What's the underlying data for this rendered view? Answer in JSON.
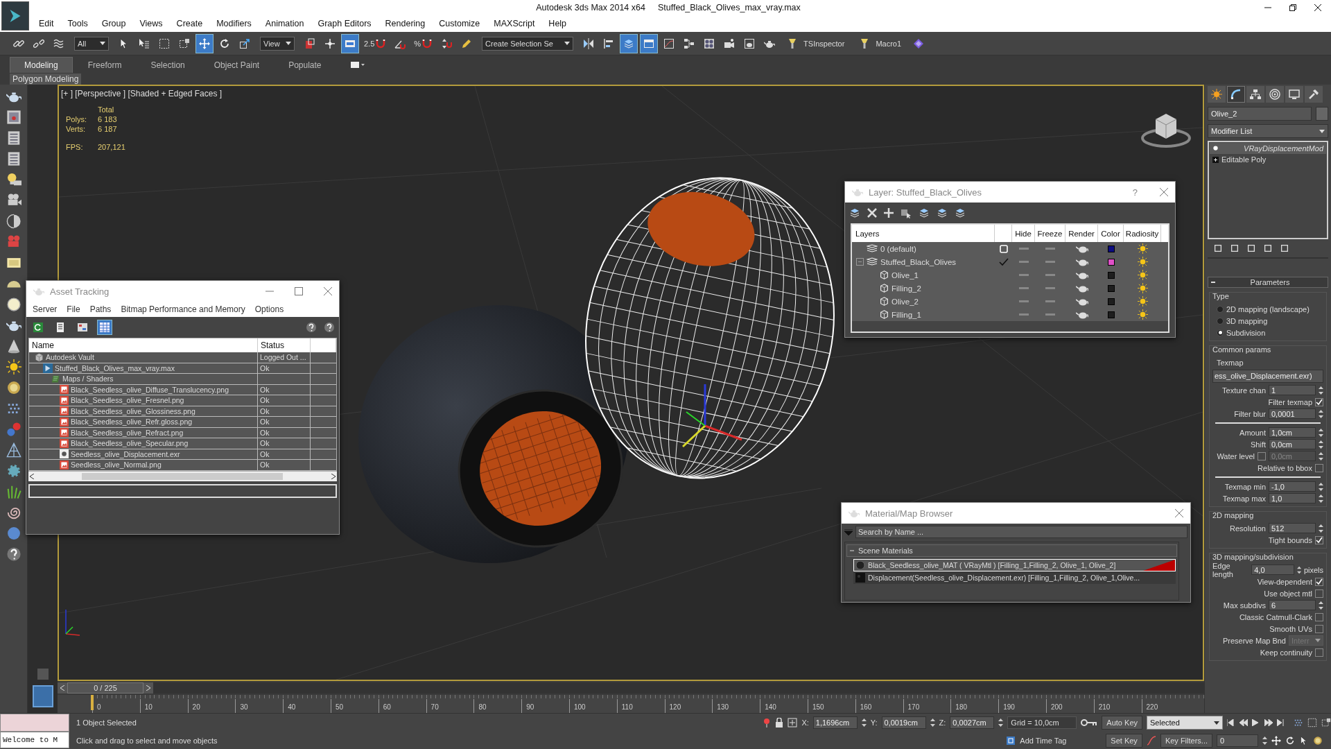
{
  "window": {
    "app_title": "Autodesk 3ds Max  2014 x64",
    "file_title": "Stuffed_Black_Olives_max_vray.max"
  },
  "menu": [
    "Edit",
    "Tools",
    "Group",
    "Views",
    "Create",
    "Modifiers",
    "Animation",
    "Graph Editors",
    "Rendering",
    "Customize",
    "MAXScript",
    "Help"
  ],
  "toolbar": {
    "tools": [
      {
        "kind": "link",
        "selected": false
      },
      {
        "kind": "unlink",
        "selected": false
      },
      {
        "kind": "bind",
        "selected": false
      },
      {
        "kind": "dropdown",
        "value": "All"
      },
      {
        "kind": "select",
        "selected": false
      },
      {
        "kind": "select_list",
        "selected": false
      },
      {
        "kind": "rect_select",
        "selected": false
      },
      {
        "kind": "window",
        "selected": false
      },
      {
        "kind": "move",
        "selected": true
      },
      {
        "kind": "rotate",
        "selected": false
      },
      {
        "kind": "scale",
        "selected": false
      },
      {
        "kind": "dropdown",
        "value": "View"
      },
      {
        "kind": "pivot",
        "selected": false
      },
      {
        "kind": "manip",
        "selected": false
      },
      {
        "kind": "kbd",
        "selected": true
      },
      {
        "kind": "snap",
        "label": "2.5",
        "selected": false
      },
      {
        "kind": "angle",
        "selected": false
      },
      {
        "kind": "percent",
        "label": "%",
        "selected": false
      },
      {
        "kind": "spinner_snap",
        "selected": false
      },
      {
        "kind": "edit_named",
        "selected": false
      },
      {
        "kind": "dropdown",
        "value": "Create Selection Se"
      },
      {
        "kind": "mirror",
        "selected": false
      },
      {
        "kind": "align",
        "selected": false
      },
      {
        "kind": "layers",
        "selected": true
      },
      {
        "kind": "ribbon",
        "selected": true
      },
      {
        "kind": "curve",
        "selected": false
      },
      {
        "kind": "schematic",
        "selected": false
      },
      {
        "kind": "material",
        "selected": false
      },
      {
        "kind": "render_setup",
        "selected": false
      },
      {
        "kind": "render_frame",
        "selected": false
      },
      {
        "kind": "render",
        "selected": false
      },
      {
        "kind": "script",
        "label": "TSInspector",
        "selected": false
      },
      {
        "kind": "script",
        "label": "Macro1",
        "selected": false
      },
      {
        "kind": "diamond",
        "selected": false
      }
    ]
  },
  "ribbon": {
    "tabs": [
      {
        "label": "Modeling",
        "selected": true
      },
      {
        "label": "Freeform",
        "selected": false
      },
      {
        "label": "Selection",
        "selected": false
      },
      {
        "label": "Object Paint",
        "selected": false
      },
      {
        "label": "Populate",
        "selected": false
      }
    ],
    "panel_label": "Polygon Modeling"
  },
  "viewport": {
    "label": "[+ ] [Perspective ] [Shaded + Edged Faces ]",
    "stats_header": "Total",
    "stats": [
      {
        "label": "Polys:",
        "value": "6 183"
      },
      {
        "label": "Verts:",
        "value": "6 187"
      },
      {
        "label": "FPS:",
        "value": "207,121"
      }
    ]
  },
  "asset_tracking": {
    "title": "Asset Tracking",
    "menu": [
      "Server",
      "File",
      "Paths",
      "Bitmap Performance and Memory",
      "Options"
    ],
    "tools": [
      {
        "kind": "refresh",
        "selected": false
      },
      {
        "kind": "list",
        "selected": false
      },
      {
        "kind": "tree",
        "selected": false
      },
      {
        "kind": "table",
        "selected": true
      }
    ],
    "columns": [
      "Name",
      "Status"
    ],
    "rows": [
      {
        "kind": "vault",
        "name": "Autodesk Vault",
        "status": "Logged Out ...",
        "children": [
          {
            "kind": "max",
            "name": "Stuffed_Black_Olives_max_vray.max",
            "status": "Ok",
            "children": [
              {
                "kind": "folder",
                "name": "Maps / Shaders",
                "children": [
                  {
                    "kind": "image",
                    "name": "Black_Seedless_olive_Diffuse_Translucency.png",
                    "status": "Ok"
                  },
                  {
                    "kind": "image",
                    "name": "Black_Seedless_olive_Fresnel.png",
                    "status": "Ok"
                  },
                  {
                    "kind": "image",
                    "name": "Black_Seedless_olive_Glossiness.png",
                    "status": "Ok"
                  },
                  {
                    "kind": "image",
                    "name": "Black_Seedless_olive_Refr.gloss.png",
                    "status": "Ok"
                  },
                  {
                    "kind": "image",
                    "name": "Black_Seedless_olive_Refract.png",
                    "status": "Ok"
                  },
                  {
                    "kind": "image",
                    "name": "Black_Seedless_olive_Specular.png",
                    "status": "Ok"
                  },
                  {
                    "kind": "exr",
                    "name": "Seedless_olive_Displacement.exr",
                    "status": "Ok"
                  },
                  {
                    "kind": "image",
                    "name": "Seedless_olive_Normal.png",
                    "status": "Ok"
                  }
                ]
              }
            ]
          }
        ]
      }
    ]
  },
  "layer_dialog": {
    "title": "Layer: Stuffed_Black_Olives",
    "help": "?",
    "columns": [
      "Layers",
      "Hide",
      "Freeze",
      "Render",
      "Color",
      "Radiosity"
    ],
    "rows": [
      {
        "name": "0 (default)",
        "kind": "layer",
        "current": false,
        "hidden": false,
        "frozen": false,
        "renderable": true,
        "color": "#0c0c80"
      },
      {
        "name": "Stuffed_Black_Olives",
        "kind": "layer",
        "current": true,
        "expanded": true,
        "hidden": false,
        "frozen": false,
        "renderable": true,
        "color": "#e050c8",
        "children": [
          {
            "name": "Olive_1",
            "kind": "object",
            "hidden": false,
            "frozen": false,
            "renderable": true,
            "color": "#1e1e1e"
          },
          {
            "name": "Filling_2",
            "kind": "object",
            "hidden": false,
            "frozen": false,
            "renderable": true,
            "color": "#1e1e1e"
          },
          {
            "name": "Olive_2",
            "kind": "object",
            "hidden": false,
            "frozen": false,
            "renderable": true,
            "color": "#1e1e1e"
          },
          {
            "name": "Filling_1",
            "kind": "object",
            "hidden": false,
            "frozen": false,
            "renderable": true,
            "color": "#1e1e1e"
          }
        ]
      }
    ]
  },
  "material_browser": {
    "title": "Material/Map Browser",
    "search": {
      "placeholder": "Search by Name ..."
    },
    "group": {
      "label": "Scene Materials",
      "expanded": true
    },
    "items": [
      {
        "kind": "material",
        "label": "Black_Seedless_olive_MAT  ( VRayMtl )  [Filling_1,Filling_2, Olive_1, Olive_2]",
        "selected": true
      },
      {
        "kind": "map",
        "label": "Displacement(Seedless_olive_Displacement.exr) [Filling_1,Filling_2, Olive_1,Olive...",
        "selected": false
      }
    ]
  },
  "command_panel": {
    "tabs": [
      {
        "kind": "create",
        "selected": false
      },
      {
        "kind": "modify",
        "selected": true
      },
      {
        "kind": "hierarchy",
        "selected": false
      },
      {
        "kind": "motion",
        "selected": false
      },
      {
        "kind": "display",
        "selected": false
      },
      {
        "kind": "utilities",
        "selected": false
      }
    ],
    "object_name": "Olive_2",
    "modifier_list": "Modifier List",
    "stack": [
      {
        "label": "VRayDisplacementMod",
        "kind": "modifier",
        "selected": true
      },
      {
        "label": "Editable Poly",
        "kind": "base",
        "expanded": false,
        "selected": false
      }
    ],
    "rollout": "Parameters",
    "groups": [
      {
        "title": "Type",
        "rows": [
          {
            "kind": "radio",
            "label": "2D mapping (landscape)",
            "selected": false
          },
          {
            "kind": "radio",
            "label": "3D mapping",
            "selected": false
          },
          {
            "kind": "radio",
            "label": "Subdivision",
            "selected": true
          }
        ]
      },
      {
        "title": "Common params",
        "rows": [
          {
            "kind": "label",
            "label": "Texmap"
          },
          {
            "kind": "map",
            "value": "ess_olive_Displacement.exr)"
          },
          {
            "kind": "spinner",
            "label": "Texture chan",
            "value": "1"
          },
          {
            "kind": "check",
            "label": "Filter texmap",
            "checked": true
          },
          {
            "kind": "spinner",
            "label": "Filter blur",
            "value": "0,0001"
          },
          {
            "kind": "rule"
          },
          {
            "kind": "spinner",
            "label": "Amount",
            "value": "1,0cm"
          },
          {
            "kind": "spinner",
            "label": "Shift",
            "value": "0,0cm"
          },
          {
            "kind": "check_spinner",
            "label": "Water level",
            "checked": false,
            "value": "0,0cm"
          },
          {
            "kind": "check",
            "label": "Relative to bbox",
            "checked": false
          },
          {
            "kind": "rule"
          },
          {
            "kind": "spinner",
            "label": "Texmap min",
            "value": "-1,0"
          },
          {
            "kind": "spinner",
            "label": "Texmap max",
            "value": "1,0"
          }
        ]
      },
      {
        "title": "2D mapping",
        "rows": [
          {
            "kind": "spinner",
            "label": "Resolution",
            "value": "512"
          },
          {
            "kind": "check",
            "label": "Tight bounds",
            "checked": true
          }
        ]
      },
      {
        "title": "3D mapping/subdivision",
        "rows": [
          {
            "kind": "spinner",
            "label": "Edge length",
            "value": "4,0",
            "unit": "pixels"
          },
          {
            "kind": "check",
            "label": "View-dependent",
            "checked": true
          },
          {
            "kind": "check",
            "label": "Use object mtl",
            "checked": false
          },
          {
            "kind": "spinner",
            "label": "Max subdivs",
            "value": "6"
          },
          {
            "kind": "check",
            "label": "Classic Catmull-Clark",
            "checked": false
          },
          {
            "kind": "check",
            "label": "Smooth UVs",
            "checked": false
          },
          {
            "kind": "dropdown",
            "label": "Preserve Map Bnd",
            "value": "Interr",
            "disabled": true
          },
          {
            "kind": "check",
            "label": "Keep continuity",
            "checked": false
          }
        ]
      }
    ]
  },
  "timeline": {
    "frame": "0 / 225",
    "level": 0,
    "ticks": [
      "0",
      "10",
      "20",
      "30",
      "40",
      "50",
      "60",
      "70",
      "80",
      "90",
      "100",
      "110",
      "120",
      "130",
      "140",
      "150",
      "160",
      "170",
      "180",
      "190",
      "200",
      "210",
      "220"
    ]
  },
  "status_bar": {
    "listener": "Welcome to M",
    "selection": "1 Object Selected",
    "prompt": "Click and drag to select and move objects",
    "coords": [
      {
        "axis": "X:",
        "value": "1,1696cm"
      },
      {
        "axis": "Y:",
        "value": "0,0019cm"
      },
      {
        "axis": "Z:",
        "value": "0,0027cm"
      }
    ],
    "grid": "Grid = 10,0cm",
    "time_tag": "Add Time Tag",
    "auto_key": "Auto Key",
    "key_mode": "Selected",
    "set_key": "Set Key",
    "key_filters": "Key Filters...",
    "current_frame": "0"
  }
}
